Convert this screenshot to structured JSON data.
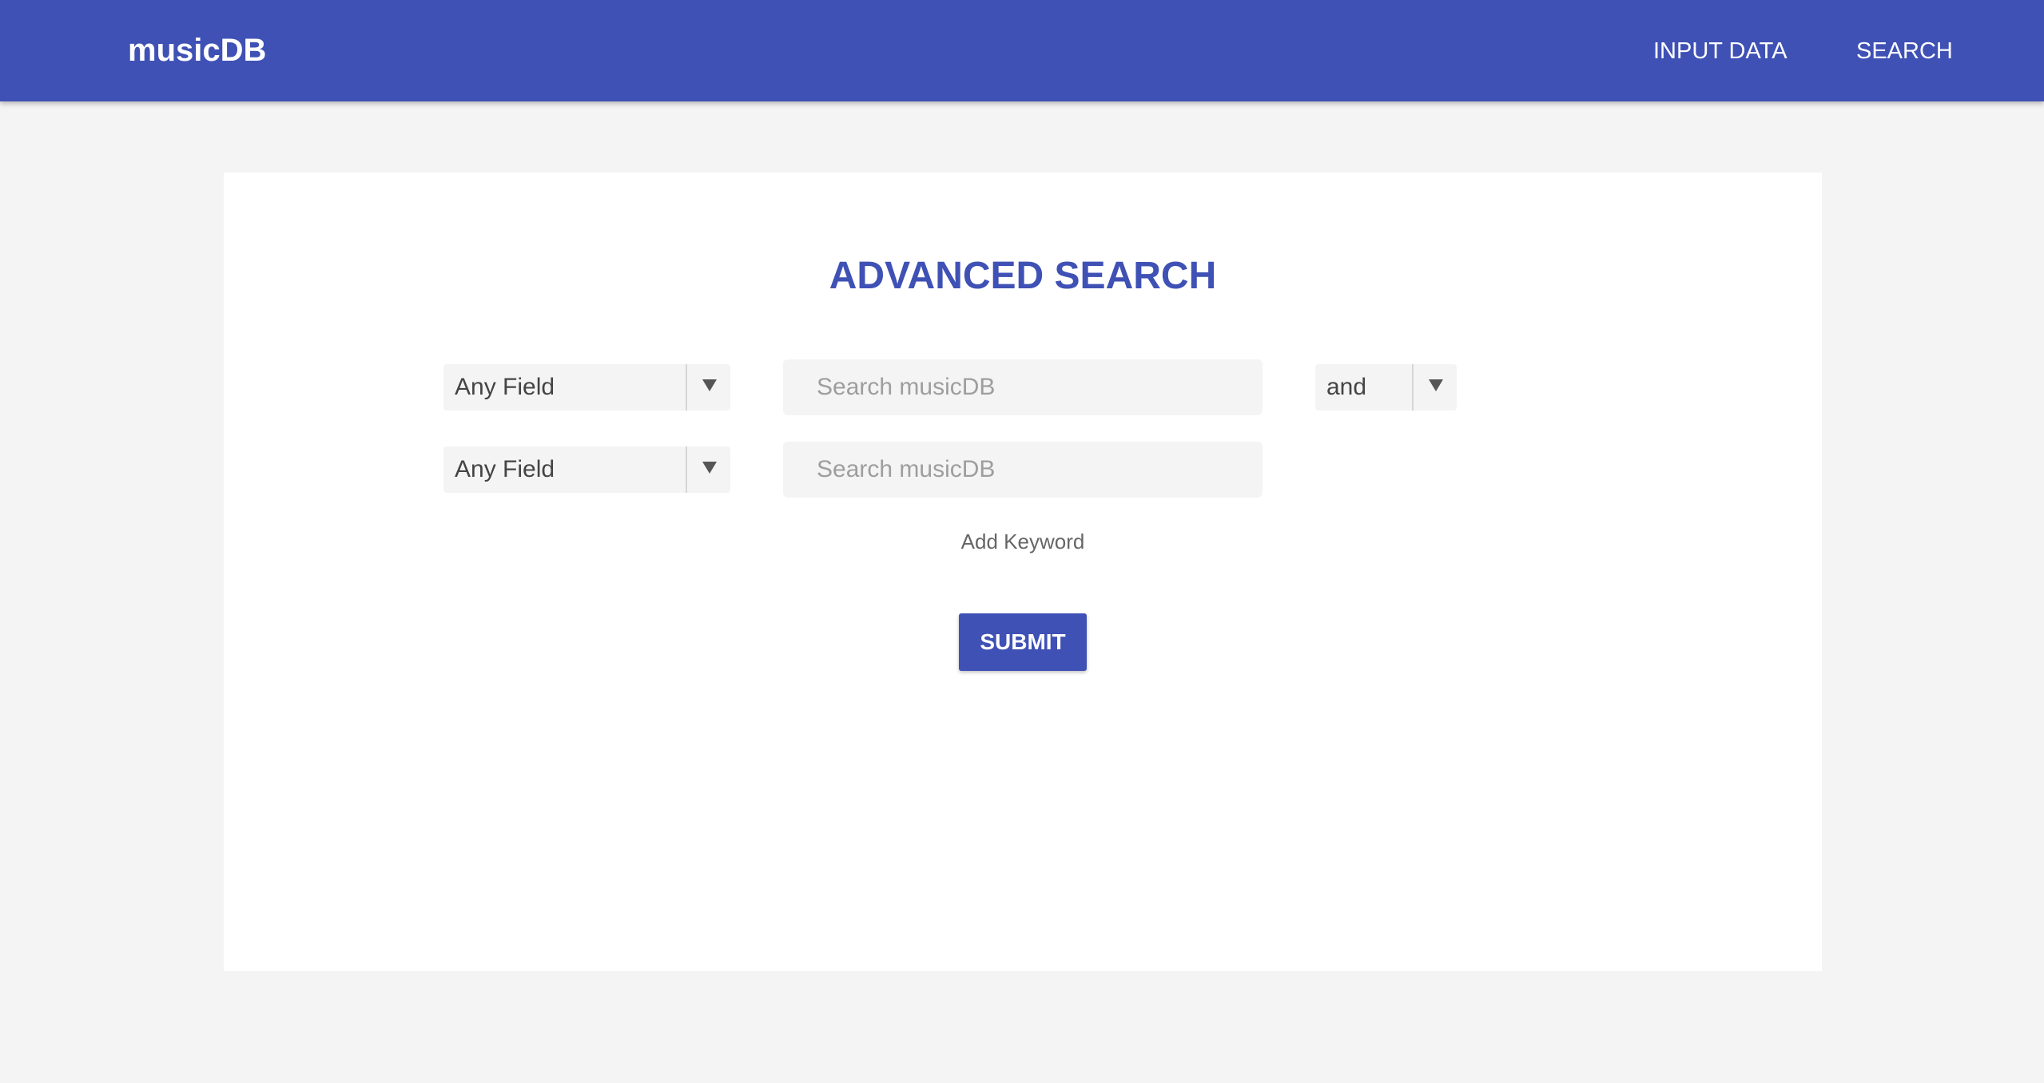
{
  "navbar": {
    "brand": "musicDB",
    "links": [
      "INPUT DATA",
      "SEARCH"
    ]
  },
  "main": {
    "title": "ADVANCED SEARCH",
    "rows": [
      {
        "field": "Any Field",
        "placeholder": "Search musicDB",
        "value": "",
        "operator": "and"
      },
      {
        "field": "Any Field",
        "placeholder": "Search musicDB",
        "value": ""
      }
    ],
    "add_keyword": "Add Keyword",
    "submit_label": "SUBMIT"
  },
  "icons": {
    "dropdown": "triangle-down-icon"
  },
  "colors": {
    "primary": "#3f51b5",
    "page_background": "#f4f4f4",
    "card_background": "#ffffff",
    "input_background": "#f4f4f4",
    "placeholder": "#9e9e9e"
  }
}
